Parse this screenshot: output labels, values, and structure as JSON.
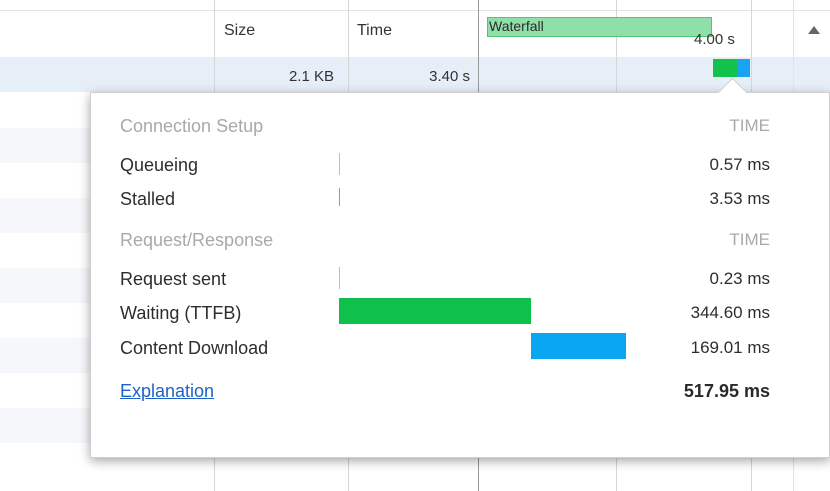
{
  "columns": {
    "size": "Size",
    "time": "Time",
    "waterfall": "Waterfall",
    "waterfall_time": "4.00 s"
  },
  "selected_row": {
    "size": "2.1 KB",
    "time": "3.40 s"
  },
  "timing_popup": {
    "sections": [
      {
        "title": "Connection Setup",
        "time_header": "TIME",
        "rows": [
          {
            "label": "Queueing",
            "value": "0.57 ms"
          },
          {
            "label": "Stalled",
            "value": "3.53 ms"
          }
        ]
      },
      {
        "title": "Request/Response",
        "time_header": "TIME",
        "rows": [
          {
            "label": "Request sent",
            "value": "0.23 ms"
          },
          {
            "label": "Waiting (TTFB)",
            "value": "344.60 ms"
          },
          {
            "label": "Content Download",
            "value": "169.01 ms"
          }
        ]
      }
    ],
    "explanation_link": "Explanation",
    "total": "517.95 ms"
  },
  "colors": {
    "waiting": "#0fc14a",
    "download": "#0aa6f2",
    "link": "#1c62c9"
  }
}
